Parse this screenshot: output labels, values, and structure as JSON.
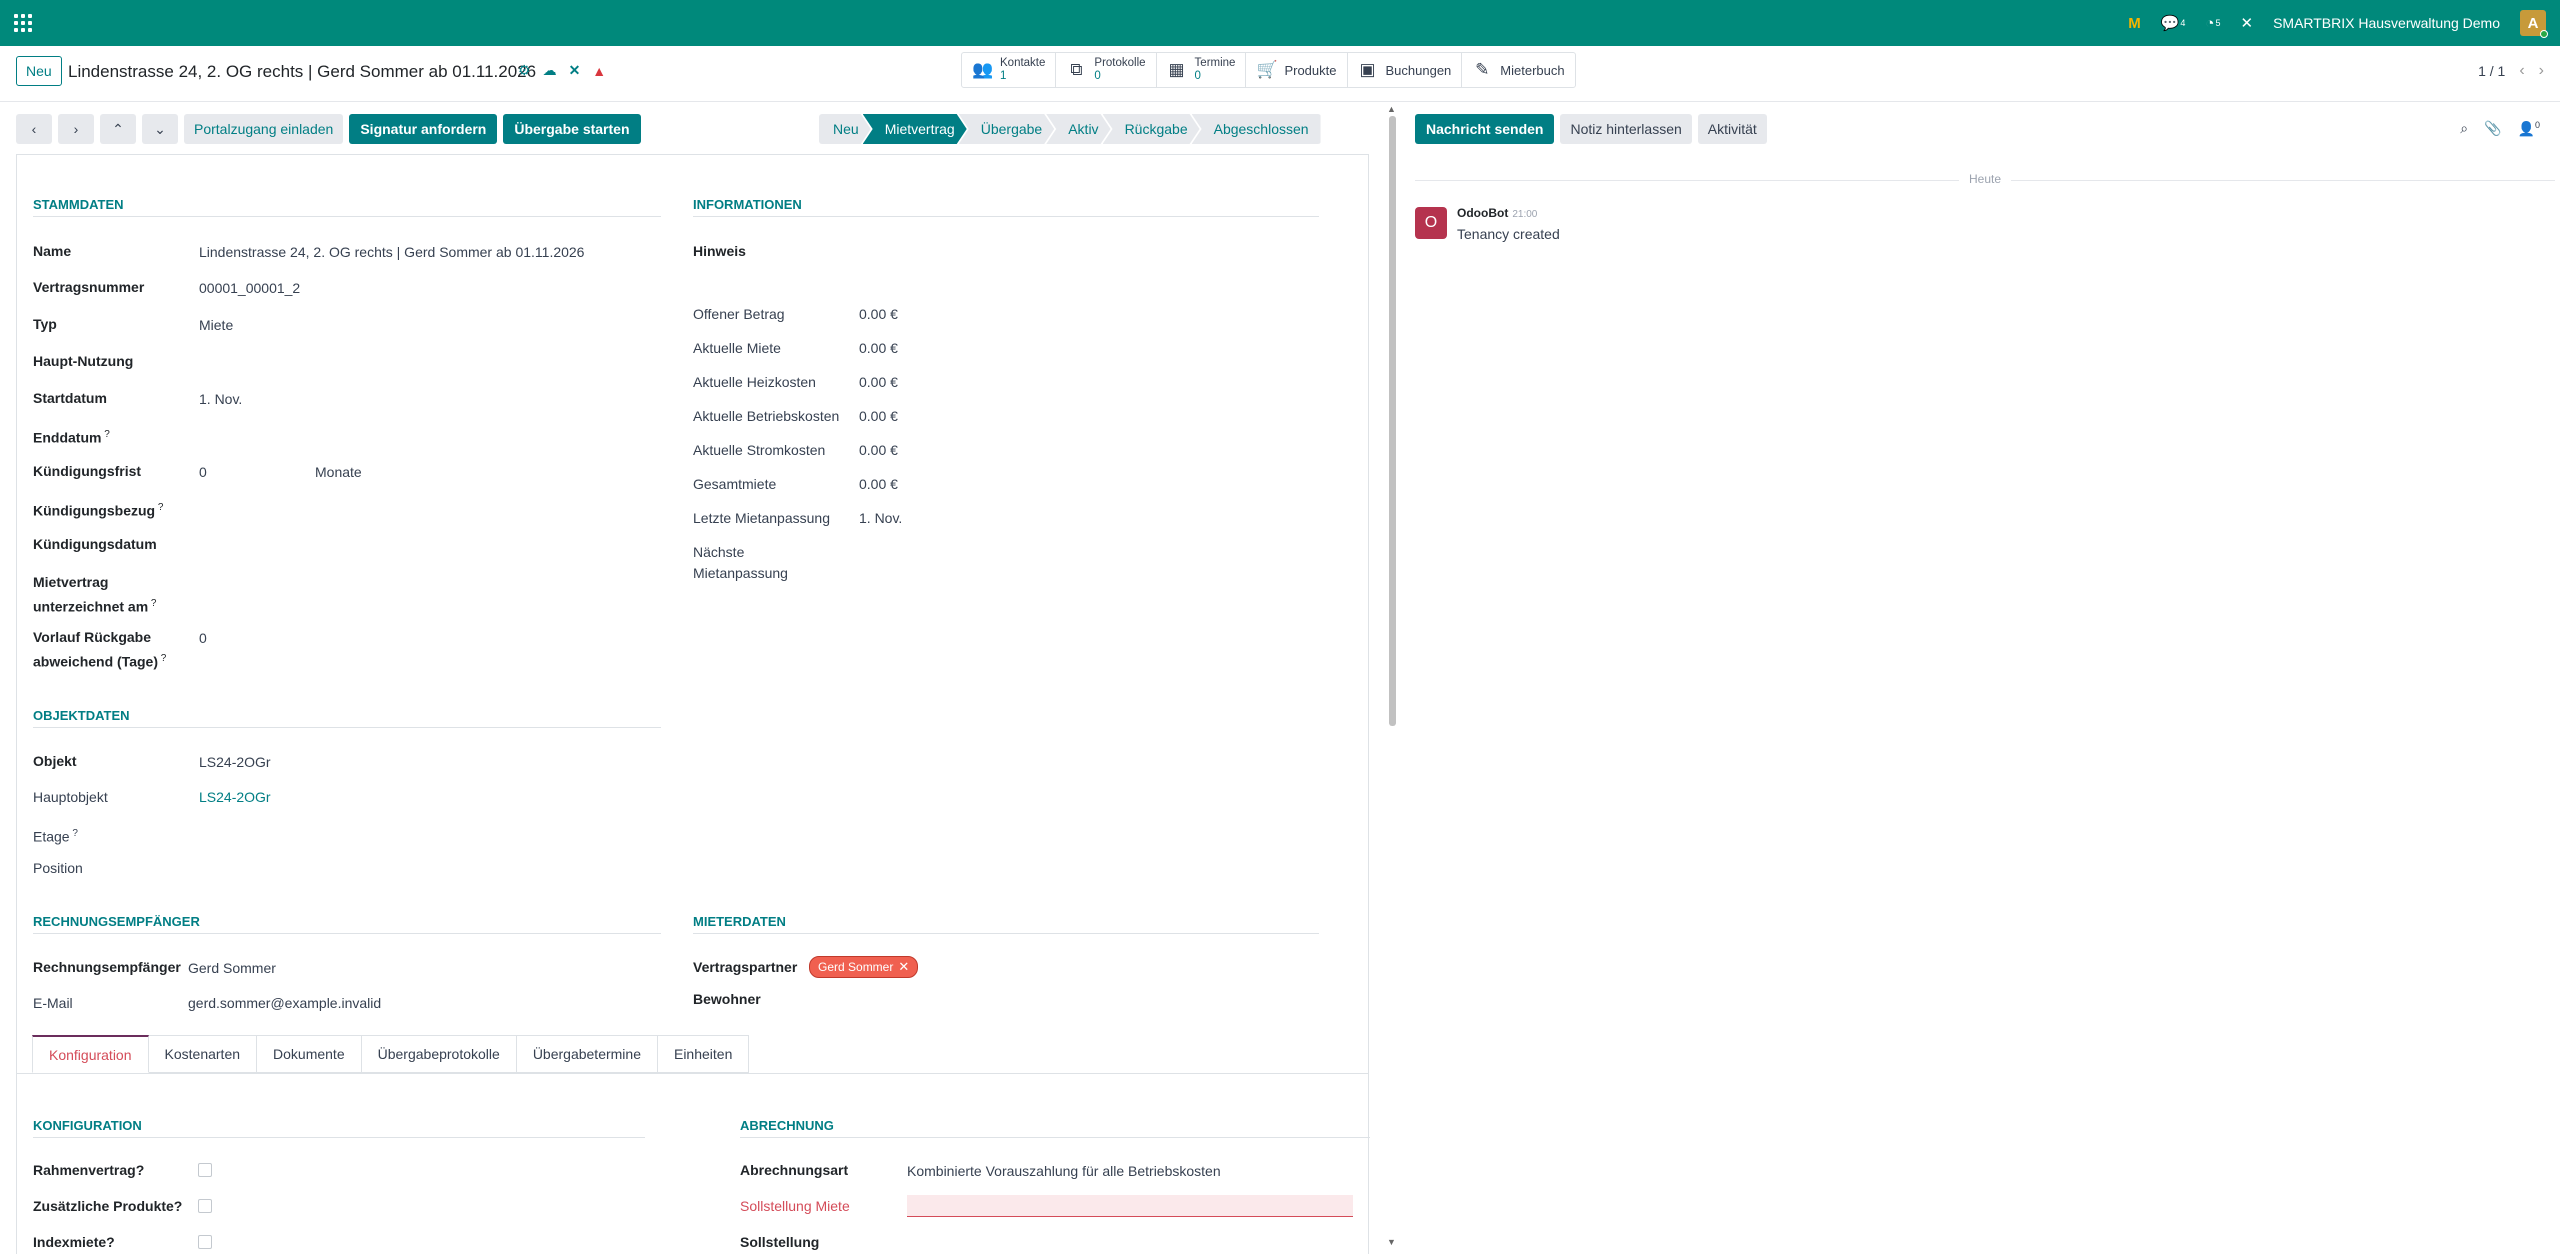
{
  "topbar": {
    "chat_count": "4",
    "activity_count": "5",
    "company": "SMARTBRIX Hausverwaltung Demo",
    "avatar_letter": "A",
    "color": "#00897b"
  },
  "control": {
    "new_label": "Neu",
    "title": "Lindenstrasse 24, 2. OG rechts | Gerd Sommer ab 01.11.2026",
    "smart_buttons": [
      {
        "label": "Kontakte",
        "count": "1",
        "icon": "users-icon"
      },
      {
        "label": "Protokolle",
        "count": "0",
        "icon": "files-icon"
      },
      {
        "label": "Termine",
        "count": "0",
        "icon": "calendar-icon"
      },
      {
        "label": "Produkte",
        "icon": "cart-icon"
      },
      {
        "label": "Buchungen",
        "icon": "money-icon"
      },
      {
        "label": "Mieterbuch",
        "icon": "edit-icon"
      }
    ],
    "pager": "1 / 1"
  },
  "statusbar": {
    "buttons": [
      "Portalzugang einladen",
      "Signatur anfordern",
      "Übergabe starten"
    ],
    "stages": [
      "Neu",
      "Mietvertrag",
      "Übergabe",
      "Aktiv",
      "Rückgabe",
      "Abgeschlossen"
    ],
    "active_stage": "Mietvertrag"
  },
  "stammdaten": {
    "title": "STAMMDATEN",
    "fields": [
      {
        "label": "Name",
        "value": "Lindenstrasse 24, 2. OG rechts | Gerd Sommer ab 01.11.2026"
      },
      {
        "label": "Vertragsnummer",
        "value": "00001_00001_2"
      },
      {
        "label": "Typ",
        "value": "Miete"
      },
      {
        "label": "Haupt-Nutzung",
        "value": ""
      },
      {
        "label": "Startdatum",
        "value": "1. Nov."
      },
      {
        "label": "Enddatum",
        "value": ""
      },
      {
        "label": "Kündigungsfrist",
        "value": "0",
        "unit": "Monate"
      },
      {
        "label": "Kündigungsbezug",
        "value": ""
      },
      {
        "label": "Kündigungsdatum",
        "value": ""
      },
      {
        "label": "Mietvertrag unterzeichnet am",
        "value": ""
      },
      {
        "label": "Vorlauf Rückgabe abweichend (Tage)",
        "value": "0"
      }
    ]
  },
  "informationen": {
    "title": "INFORMATIONEN",
    "hinweis": "Hinweis",
    "fields": [
      {
        "label": "Offener Betrag",
        "value": "0.00 €"
      },
      {
        "label": "Aktuelle Miete",
        "value": "0.00 €"
      },
      {
        "label": "Aktuelle Heizkosten",
        "value": "0.00 €"
      },
      {
        "label": "Aktuelle Betriebskosten",
        "value": "0.00 €"
      },
      {
        "label": "Aktuelle Stromkosten",
        "value": "0.00 €"
      },
      {
        "label": "Gesamtmiete",
        "value": "0.00 €"
      },
      {
        "label": "Letzte Mietanpassung",
        "value": "1. Nov."
      },
      {
        "label": "Nächste Mietanpassung",
        "value": ""
      }
    ]
  },
  "objektdaten": {
    "title": "OBJEKTDATEN",
    "fields": [
      {
        "label": "Objekt",
        "value": "LS24-2OGr"
      },
      {
        "label": "Hauptobjekt",
        "value": "LS24-2OGr"
      },
      {
        "label": "Etage",
        "value": ""
      },
      {
        "label": "Position",
        "value": ""
      }
    ]
  },
  "rechnung": {
    "title": "RECHNUNGSEMPFÄNGER",
    "fields": [
      {
        "label": "Rechnungsempfänger",
        "value": "Gerd Sommer"
      },
      {
        "label": "E-Mail",
        "value": "gerd.sommer@example.invalid"
      }
    ]
  },
  "mieterdaten": {
    "title": "MIETERDATEN",
    "vertragspartner_label": "Vertragspartner",
    "vertragspartner_tag": "Gerd Sommer",
    "bewohner_label": "Bewohner"
  },
  "tabs": [
    "Konfiguration",
    "Kostenarten",
    "Dokumente",
    "Übergabeprotokolle",
    "Übergabetermine",
    "Einheiten"
  ],
  "konfiguration": {
    "title": "KONFIGURATION",
    "fields": [
      "Rahmenvertrag?",
      "Zusätzliche Produkte?",
      "Indexmiete?"
    ]
  },
  "abrechnung": {
    "title": "ABRECHNUNG",
    "abrechnungsart_label": "Abrechnungsart",
    "abrechnungsart_value": "Kombinierte Vorauszahlung für alle Betriebskosten",
    "sollstellung_miete_label": "Sollstellung Miete",
    "sollstellung_label": "Sollstellung"
  },
  "chatter": {
    "buttons": [
      "Nachricht senden",
      "Notiz hinterlassen",
      "Aktivität"
    ],
    "follower_count": "0",
    "date_sep": "Heute",
    "author": "OdooBot",
    "time": "21:00",
    "avatar_letter": "O",
    "body": "Tenancy created"
  }
}
